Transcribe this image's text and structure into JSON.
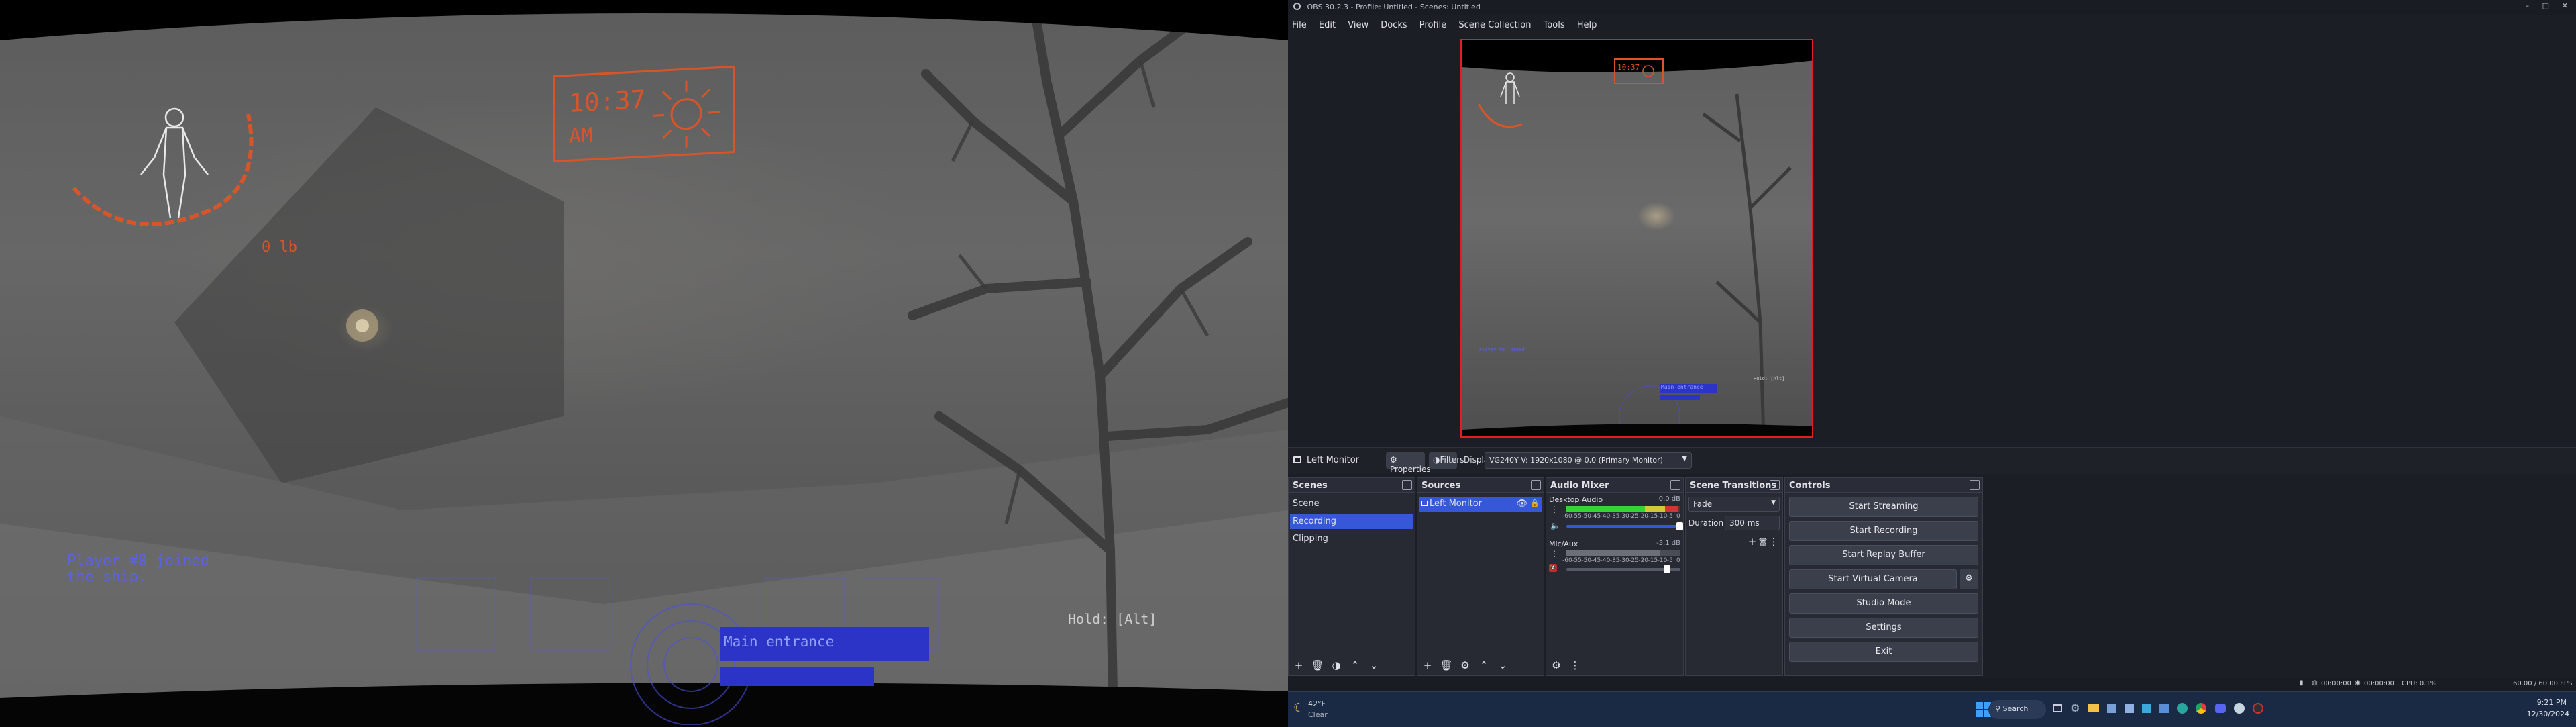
{
  "game": {
    "clock_time": "10:37",
    "clock_period": "AM",
    "weight": "0 lb",
    "chat_line1": "Player #0 joined",
    "chat_line2": "the ship.",
    "objective_label": "Main entrance",
    "hold_prompt": "Hold: [Alt]"
  },
  "obs": {
    "window_title": "OBS 30.2.3 - Profile: Untitled - Scenes: Untitled",
    "menu": [
      "File",
      "Edit",
      "View",
      "Docks",
      "Profile",
      "Scene Collection",
      "Tools",
      "Help"
    ],
    "source_bar": {
      "selected_source": "Left Monitor",
      "properties_label": "Properties",
      "filters_label": "Filters",
      "display_label": "Display",
      "display_value": "VG240Y V: 1920x1080 @ 0,0 (Primary Monitor)"
    },
    "scenes": {
      "title": "Scenes",
      "items": [
        "Scene",
        "Recording",
        "Clipping"
      ],
      "selected": "Recording"
    },
    "sources": {
      "title": "Sources",
      "items": [
        "Left Monitor"
      ]
    },
    "audio_mixer": {
      "title": "Audio Mixer",
      "desktop": {
        "name": "Desktop Audio",
        "db": "0.0 dB",
        "level": 0.98
      },
      "mic": {
        "name": "Mic/Aux",
        "db": "-3.1 dB",
        "level": 0.82
      },
      "ticks": [
        "-60",
        "-55",
        "-50",
        "-45",
        "-40",
        "-35",
        "-30",
        "-25",
        "-20",
        "-15",
        "-10",
        "-5",
        "0"
      ]
    },
    "transitions": {
      "title": "Scene Transitions",
      "type": "Fade",
      "duration_label": "Duration",
      "duration_value": "300 ms"
    },
    "controls": {
      "title": "Controls",
      "buttons": [
        "Start Streaming",
        "Start Recording",
        "Start Replay Buffer",
        "Start Virtual Camera",
        "Studio Mode",
        "Settings",
        "Exit"
      ]
    },
    "status": {
      "stream_time": "00:00:00",
      "record_time": "00:00:00",
      "cpu": "CPU: 0.1%",
      "fps": "60.00 / 60.00 FPS"
    }
  },
  "taskbar": {
    "weather_temp": "42°F",
    "weather_desc": "Clear",
    "search_placeholder": "Search",
    "time": "9:21 PM",
    "date": "12/30/2024"
  },
  "colors": {
    "hud_orange": "#d8552a",
    "hud_blue": "#3c46e6",
    "obs_bg": "#1c1e26",
    "obs_select": "#3657d8",
    "preview_border": "#e02020"
  }
}
